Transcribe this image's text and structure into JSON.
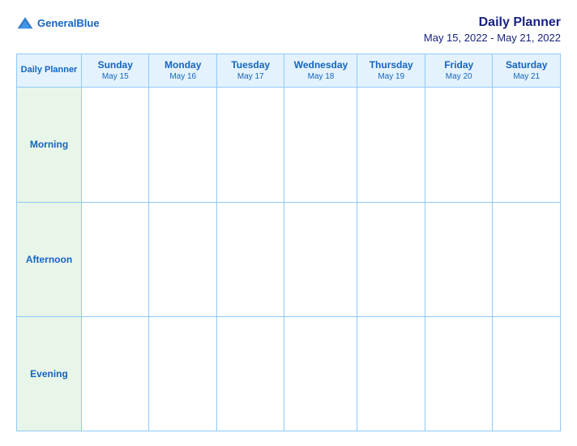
{
  "header": {
    "logo_general": "General",
    "logo_blue": "Blue",
    "title": "Daily Planner",
    "date_range": "May 15, 2022 - May 21, 2022"
  },
  "table": {
    "label_col": "Daily Planner",
    "days": [
      {
        "name": "Sunday",
        "date": "May 15"
      },
      {
        "name": "Monday",
        "date": "May 16"
      },
      {
        "name": "Tuesday",
        "date": "May 17"
      },
      {
        "name": "Wednesday",
        "date": "May 18"
      },
      {
        "name": "Thursday",
        "date": "May 19"
      },
      {
        "name": "Friday",
        "date": "May 20"
      },
      {
        "name": "Saturday",
        "date": "May 21"
      }
    ],
    "rows": [
      {
        "label": "Morning"
      },
      {
        "label": "Afternoon"
      },
      {
        "label": "Evening"
      }
    ]
  }
}
